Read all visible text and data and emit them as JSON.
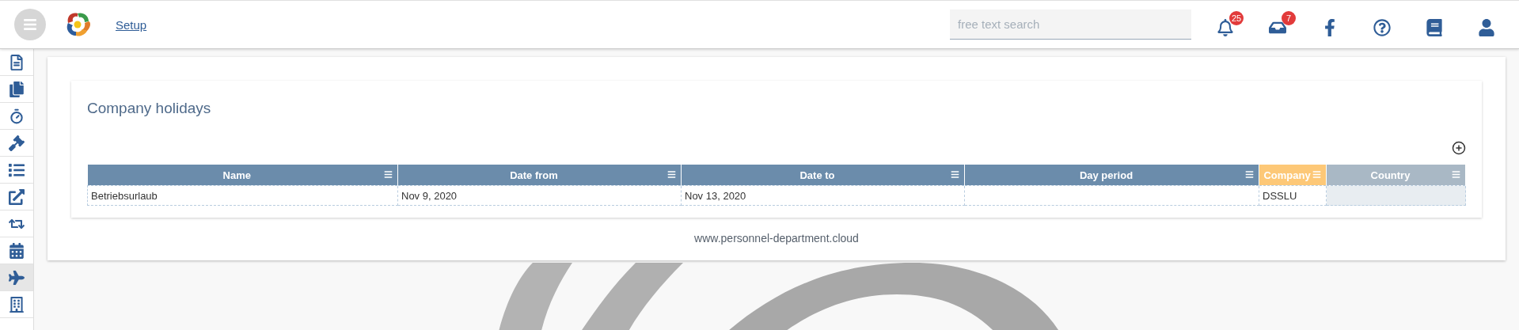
{
  "header": {
    "breadcrumb": "Setup",
    "search": {
      "placeholder": "free text search"
    },
    "notifications": "25",
    "messages": "7"
  },
  "sidebar": {
    "items": [
      {
        "selected": false
      },
      {
        "selected": false
      },
      {
        "selected": false
      },
      {
        "selected": false
      },
      {
        "selected": false
      },
      {
        "selected": false
      },
      {
        "selected": false
      },
      {
        "selected": false
      },
      {
        "selected": true
      },
      {
        "selected": false
      }
    ]
  },
  "panel": {
    "title": "Company holidays",
    "table": {
      "columns": [
        {
          "label": "Name",
          "kind": "normal"
        },
        {
          "label": "Date from",
          "kind": "normal"
        },
        {
          "label": "Date to",
          "kind": "normal"
        },
        {
          "label": "Day period",
          "kind": "normal"
        },
        {
          "label": "Company",
          "kind": "highlight"
        },
        {
          "label": "Country",
          "kind": "muted"
        }
      ],
      "rows": [
        {
          "cells": [
            "Betriebsurlaub",
            "Nov 9, 2020",
            "Nov 13, 2020",
            null,
            "DSSLU",
            null
          ]
        }
      ]
    }
  },
  "footer": "www.personnel-department.cloud"
}
